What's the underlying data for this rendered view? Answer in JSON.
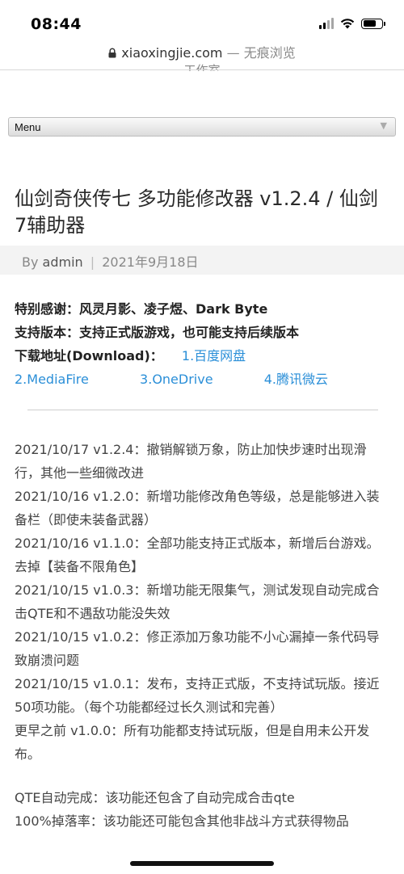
{
  "status_bar": {
    "time": "08:44"
  },
  "browser": {
    "url": "xiaoxingjie.com",
    "mode": " — 无痕浏览",
    "cut_text": "工作室"
  },
  "menu": {
    "label": "Menu",
    "arrow": "▼"
  },
  "post": {
    "title": "仙剑奇侠传七 多功能修改器 v1.2.4 / 仙剑7辅助器",
    "meta": {
      "by": "By ",
      "author": "admin",
      "separator": "|",
      "date": "2021年9月18日"
    }
  },
  "info": {
    "thanks": "特别感谢：风灵月影、凌子煜、Dark Byte",
    "support": "支持版本：支持正式版游戏，也可能支持后续版本",
    "download_label": "下载地址(Download)：",
    "links": [
      "1.百度网盘",
      "2.MediaFire",
      "3.OneDrive",
      "4.腾讯微云"
    ]
  },
  "changelog": [
    "2021/10/17 v1.2.4：撤销解锁万象，防止加快步速时出现滑行，其他一些细微改进",
    "2021/10/16 v1.2.0：新增功能修改角色等级，总是能够进入装备栏（即使未装备武器）",
    "2021/10/16 v1.1.0：全部功能支持正式版本，新增后台游戏。去掉【装备不限角色】",
    "2021/10/15 v1.0.3：新增功能无限集气，测试发现自动完成合击QTE和不遇敌功能没失效",
    "2021/10/15 v1.0.2：修正添加万象功能不小心漏掉一条代码导致崩溃问题",
    "2021/10/15 v1.0.1：发布，支持正式版，不支持试玩版。接近50项功能。（每个功能都经过长久测试和完善）",
    "更早之前 v1.0.0：所有功能都支持试玩版，但是自用未公开发布。"
  ],
  "notes": [
    "QTE自动完成：该功能还包含了自动完成合击qte",
    "100%掉落率：该功能还可能包含其他非战斗方式获得物品"
  ]
}
